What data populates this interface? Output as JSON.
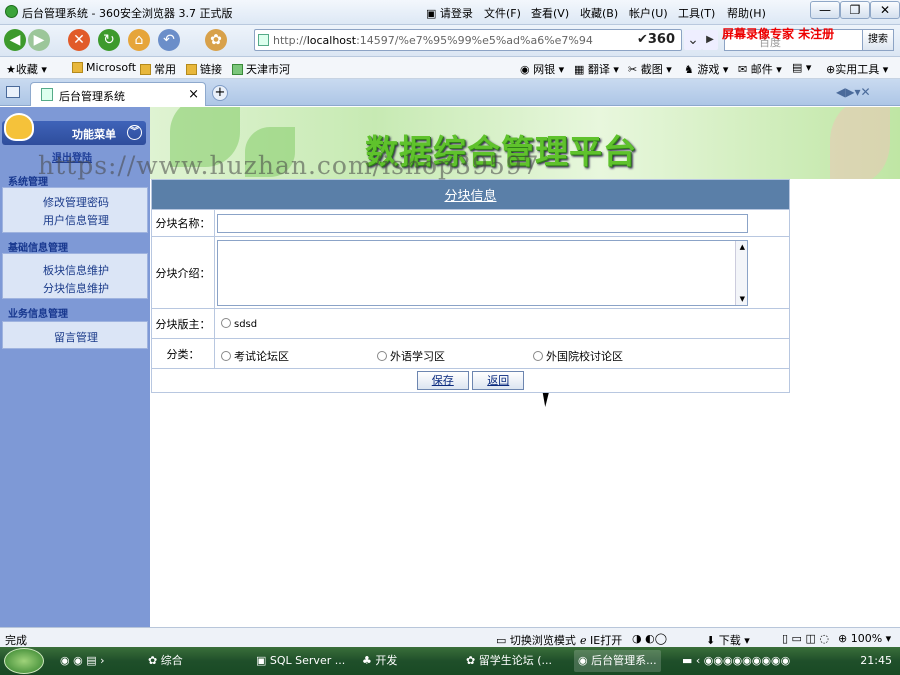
{
  "browser": {
    "window_title": "后台管理系统 - 360安全浏览器 3.7 正式版",
    "login_label": "请登录",
    "menu": [
      "文件(F)",
      "查看(V)",
      "收藏(B)",
      "帐户(U)",
      "工具(T)",
      "帮助(H)"
    ],
    "url": "http://localhost:14597/%e7%95%99%e5%ad%a6%e7%94",
    "url_prefix": "http://",
    "url_host": "localhost",
    "url_rest": ":14597/%e7%95%99%e5%ad%a6%e7%94",
    "brand_360": "360",
    "search_button": "搜索",
    "search_placeholder": "百度",
    "overlay_watermark": "屏幕录像专家  未注册",
    "favorites": [
      "收藏",
      "Microsoft",
      "常用",
      "链接",
      "天津市河"
    ],
    "toolbar_right": [
      "网银",
      "翻译",
      "截图",
      "游戏",
      "邮件",
      "实用工具"
    ],
    "tab_title": "后台管理系统"
  },
  "sidebar": {
    "header": "功能菜单",
    "logout": "退出登陆",
    "groups": [
      {
        "title": "系统管理",
        "items": [
          "修改管理密码",
          "用户信息管理"
        ]
      },
      {
        "title": "基础信息管理",
        "items": [
          "板块信息维护",
          "分块信息维护"
        ]
      },
      {
        "title": "业务信息管理",
        "items": [
          "留言管理"
        ]
      }
    ]
  },
  "banner": {
    "title": "数据综合管理平台"
  },
  "watermark": "https://www.huzhan.com/ishop39597",
  "form": {
    "header": "分块信息",
    "name_label": "分块名称：",
    "name_value": "",
    "intro_label": "分块介绍：",
    "intro_value": "",
    "owner_label": "分块版主：",
    "owner_option": "sdsd",
    "category_label": "分类：",
    "categories": [
      "考试论坛区",
      "外语学习区",
      "外国院校讨论区"
    ],
    "save_button": "保存",
    "back_button": "返回"
  },
  "status": {
    "left": "完成",
    "mode_switch": "切换浏览模式",
    "ie_open": "IE打开",
    "download": "下载",
    "zoom": "100%"
  },
  "taskbar": {
    "items": [
      "综合",
      "SQL Server ...",
      "开发",
      "留学生论坛 (...",
      "后台管理系..."
    ],
    "time": "21:45"
  }
}
